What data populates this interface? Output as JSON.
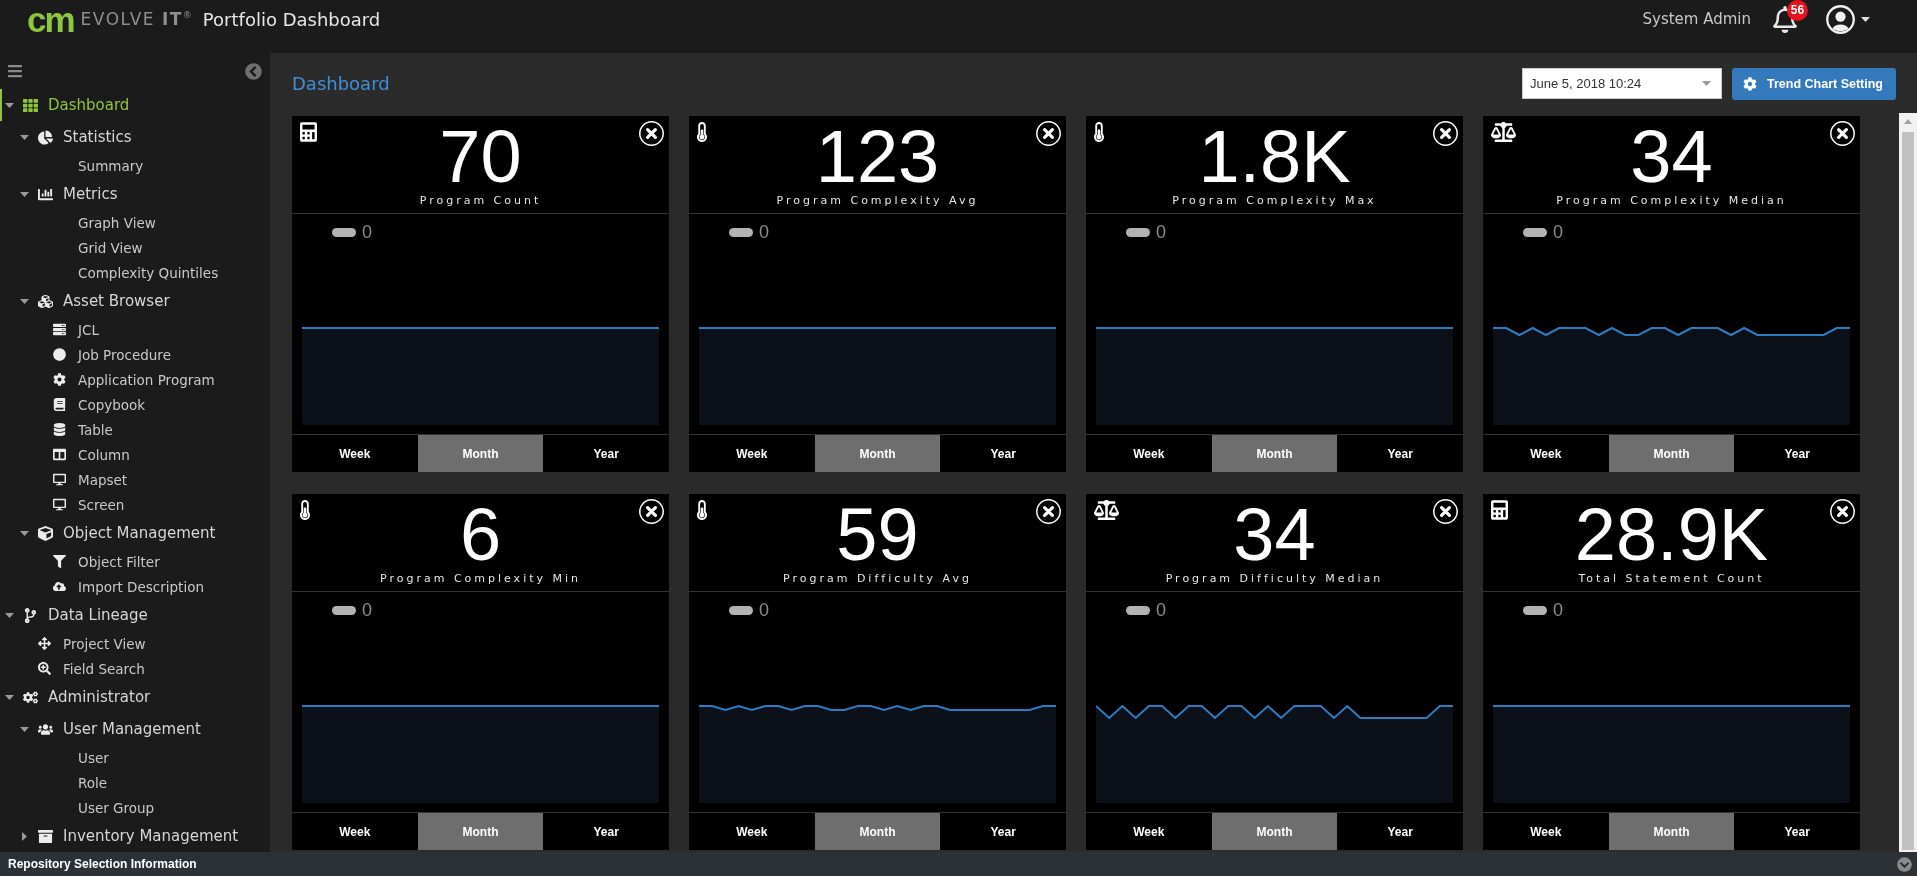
{
  "header": {
    "logo_mark": "cm",
    "logo_text": "EVOLVE **IT**$^{®}$",
    "title": "Portfolio Dashboard",
    "user_name": "System Admin",
    "notification_count": "56"
  },
  "sidebar": {
    "items": [
      {
        "label": "Dashboard",
        "selected": true,
        "expanded": true,
        "children": [
          {
            "label": "Statistics",
            "selected": false,
            "expanded": true,
            "children": [
              {
                "label": "Summary",
                "selected": false
              }
            ]
          },
          {
            "label": "Metrics",
            "selected": false,
            "expanded": true,
            "children": [
              {
                "label": "Graph View",
                "selected": false
              },
              {
                "label": "Grid View",
                "selected": false
              },
              {
                "label": "Complexity Quintiles",
                "selected": false
              }
            ]
          },
          {
            "label": "Asset Browser",
            "selected": false,
            "expanded": true,
            "children": [
              {
                "label": "JCL",
                "selected": false
              },
              {
                "label": "Job Procedure",
                "selected": false
              },
              {
                "label": "Application Program",
                "selected": false
              },
              {
                "label": "Copybook",
                "selected": false
              },
              {
                "label": "Table",
                "selected": false
              },
              {
                "label": "Column",
                "selected": false
              },
              {
                "label": "Mapset",
                "selected": false
              },
              {
                "label": "Screen",
                "selected": false
              }
            ]
          },
          {
            "label": "Object Management",
            "selected": false,
            "expanded": true,
            "children": [
              {
                "label": "Object Filter",
                "selected": false
              },
              {
                "label": "Import Description",
                "selected": false
              }
            ]
          }
        ]
      },
      {
        "label": "Data Lineage",
        "selected": false,
        "expanded": true,
        "children": [
          {
            "label": "Project View",
            "selected": false
          },
          {
            "label": "Field Search",
            "selected": false
          }
        ]
      },
      {
        "label": "Administrator",
        "selected": false,
        "expanded": true,
        "children": [
          {
            "label": "User Management",
            "selected": false,
            "expanded": true,
            "children": [
              {
                "label": "User",
                "selected": false
              },
              {
                "label": "Role",
                "selected": false
              },
              {
                "label": "User Group",
                "selected": false
              }
            ]
          },
          {
            "label": "Inventory Management",
            "selected": false,
            "expanded": false
          }
        ]
      }
    ]
  },
  "dashboard": {
    "title": "Dashboard",
    "date_select": {
      "value": "June 5, 2018 10:24"
    },
    "settings_button": {
      "label": "Trend Chart Setting"
    }
  },
  "cards": [
    {
      "value": "70",
      "label": "Program Count",
      "legend": "0",
      "periods": [
        {
          "label": "Week",
          "selected": false
        },
        {
          "label": "Month",
          "selected": true
        },
        {
          "label": "Year",
          "selected": false
        }
      ]
    },
    {
      "value": "123",
      "label": "Program Complexity Avg",
      "legend": "0",
      "periods": [
        {
          "label": "Week",
          "selected": false
        },
        {
          "label": "Month",
          "selected": true
        },
        {
          "label": "Year",
          "selected": false
        }
      ]
    },
    {
      "value": "1.8K",
      "label": "Program Complexity Max",
      "legend": "0",
      "periods": [
        {
          "label": "Week",
          "selected": false
        },
        {
          "label": "Month",
          "selected": true
        },
        {
          "label": "Year",
          "selected": false
        }
      ]
    },
    {
      "value": "34",
      "label": "Program Complexity Median",
      "legend": "0",
      "periods": [
        {
          "label": "Week",
          "selected": false
        },
        {
          "label": "Month",
          "selected": true
        },
        {
          "label": "Year",
          "selected": false
        }
      ]
    },
    {
      "value": "6",
      "label": "Program Complexity Min",
      "legend": "0",
      "periods": [
        {
          "label": "Week",
          "selected": false
        },
        {
          "label": "Month",
          "selected": true
        },
        {
          "label": "Year",
          "selected": false
        }
      ]
    },
    {
      "value": "59",
      "label": "Program Difficulty Avg",
      "legend": "0",
      "periods": [
        {
          "label": "Week",
          "selected": false
        },
        {
          "label": "Month",
          "selected": true
        },
        {
          "label": "Year",
          "selected": false
        }
      ]
    },
    {
      "value": "34",
      "label": "Program Difficulty Median",
      "legend": "0",
      "periods": [
        {
          "label": "Week",
          "selected": false
        },
        {
          "label": "Month",
          "selected": true
        },
        {
          "label": "Year",
          "selected": false
        }
      ]
    },
    {
      "value": "28.9K",
      "label": "Total Statement Count",
      "legend": "0",
      "periods": [
        {
          "label": "Week",
          "selected": false
        },
        {
          "label": "Month",
          "selected": true
        },
        {
          "label": "Year",
          "selected": false
        }
      ]
    }
  ],
  "footer": {
    "title": "Repository Selection Information"
  }
}
